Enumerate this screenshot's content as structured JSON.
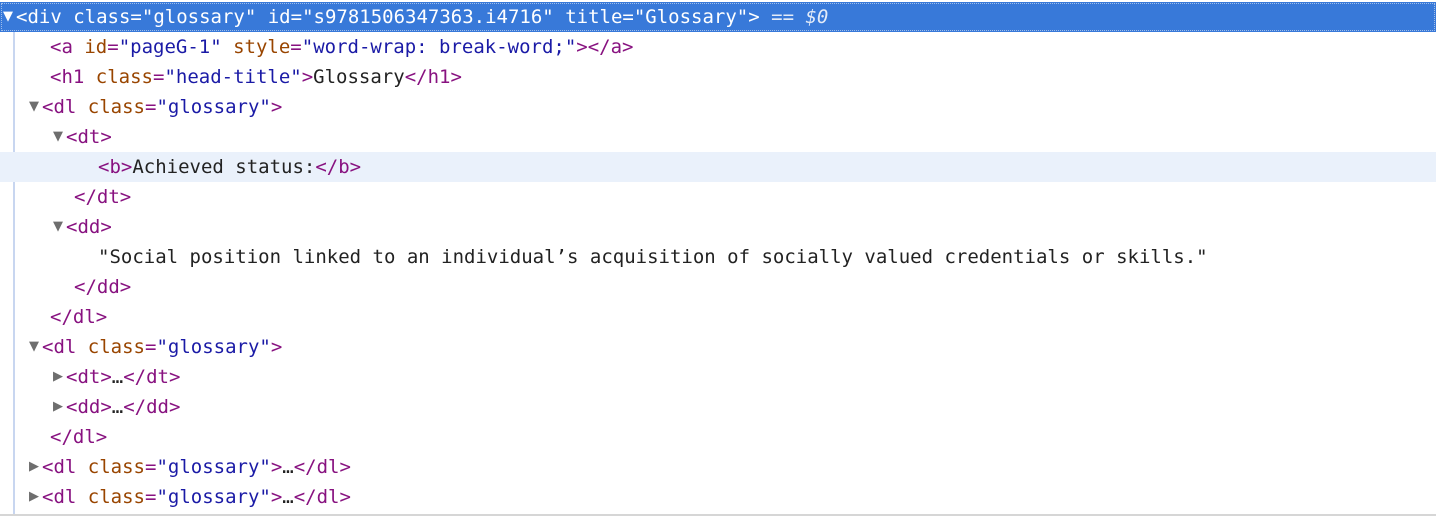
{
  "nodes": {
    "root": {
      "open": "<div",
      "a1": "class",
      "v1": "\"glossary\"",
      "a2": "id",
      "v2": "\"s9781506347363.i4716\"",
      "a3": "title",
      "v3": "\"Glossary\"",
      "close": ">",
      "hint": " == ",
      "dollar": "$0"
    },
    "anchor": {
      "open": "<a",
      "a1": "id",
      "v1": "\"pageG-1\"",
      "a2": "style",
      "v2": "\"word-wrap: break-word;\"",
      "close": "></a>"
    },
    "h1": {
      "open": "<h1",
      "a1": "class",
      "v1": "\"head-title\"",
      "gt": ">",
      "text": "Glossary",
      "close": "</h1>"
    },
    "dl1": {
      "open": "<dl",
      "a1": "class",
      "v1": "\"glossary\"",
      "gt": ">",
      "dt_open": "<dt>",
      "b_open": "<b>",
      "b_text": "Achieved status:",
      "b_close": "</b>",
      "dt_close": "</dt>",
      "dd_open": "<dd>",
      "dd_text": "\"Social position linked to an individual’s acquisition of socially valued credentials or skills.\"",
      "dd_close": "</dd>",
      "close": "</dl>"
    },
    "dl2": {
      "open": "<dl",
      "a1": "class",
      "v1": "\"glossary\"",
      "gt": ">",
      "dt_open": "<dt>",
      "dt_ellipsis": "…",
      "dt_close": "</dt>",
      "dd_open": "<dd>",
      "dd_ellipsis": "…",
      "dd_close": "</dd>",
      "close": "</dl>"
    },
    "dl3": {
      "open": "<dl",
      "a1": "class",
      "v1": "\"glossary\"",
      "gt": ">",
      "ellipsis": "…",
      "close": "</dl>"
    },
    "dl4": {
      "open": "<dl",
      "a1": "class",
      "v1": "\"glossary\"",
      "gt": ">",
      "ellipsis": "…",
      "close": "</dl>"
    }
  },
  "icons": {
    "expanded": "▼",
    "collapsed": "▶"
  },
  "colors": {
    "selection": "#3879d9",
    "hover": "#eaf1fb",
    "tag": "#881280",
    "attribute_name": "#994500",
    "attribute_value": "#1a1aa6"
  }
}
